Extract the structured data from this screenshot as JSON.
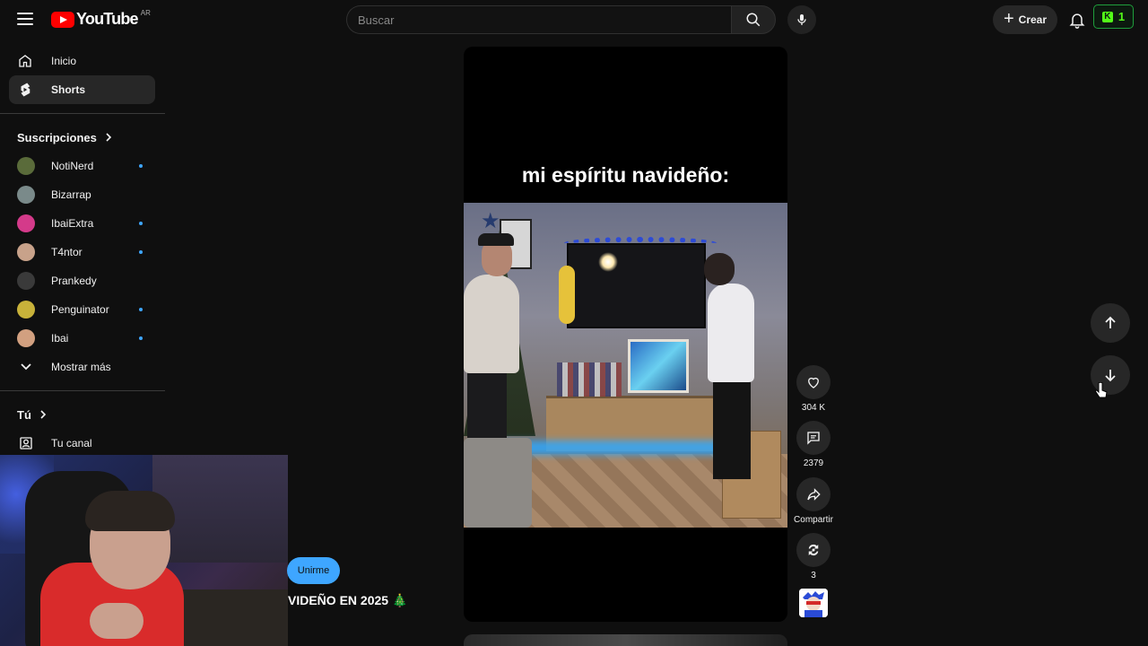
{
  "header": {
    "logo_text": "YouTube",
    "logo_country": "AR",
    "search_placeholder": "Buscar",
    "create_label": "Crear",
    "kick_count": "1"
  },
  "sidebar": {
    "main": [
      {
        "label": "Inicio",
        "icon": "home-icon"
      },
      {
        "label": "Shorts",
        "icon": "shorts-icon",
        "active": true
      }
    ],
    "subscriptions_title": "Suscripciones",
    "subscriptions": [
      {
        "label": "NotiNerd",
        "live": true,
        "color": "#5a6b3a"
      },
      {
        "label": "Bizarrap",
        "live": false,
        "color": "#7a8a8a"
      },
      {
        "label": "IbaiExtra",
        "live": true,
        "color": "#d43a8a"
      },
      {
        "label": "T4ntor",
        "live": true,
        "color": "#c8a28a"
      },
      {
        "label": "Prankedy",
        "live": false,
        "color": "#3a3a3a"
      },
      {
        "label": "Penguinator",
        "live": true,
        "color": "#c8b23a"
      },
      {
        "label": "Ibai",
        "live": true,
        "color": "#d2a080"
      }
    ],
    "show_more": "Mostrar más",
    "you_title": "Tú",
    "your_channel": "Tu canal"
  },
  "overlay": {
    "join_label": "Unirme",
    "live_title": "VIDEÑO EN 2025 🎄"
  },
  "short": {
    "caption": "mi espíritu navideño:",
    "likes": "304 K",
    "comments": "2379",
    "share": "Compartir",
    "remix": "3"
  },
  "colors": {
    "background": "#0f0f0f",
    "accent": "#3ea6ff",
    "brand": "#ff0000",
    "kick": "#53fc18"
  }
}
